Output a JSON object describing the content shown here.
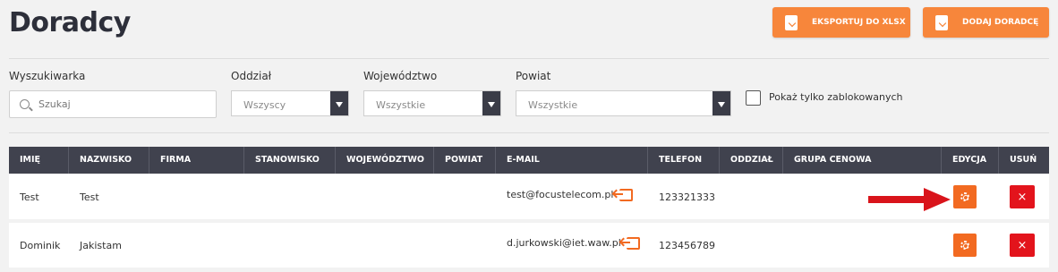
{
  "page": {
    "title": "Doradcy"
  },
  "toolbar": {
    "export_label": "EKSPORTUJ DO XLSX",
    "add_label": "DODAJ DORADCĘ"
  },
  "filters": {
    "search_label": "Wyszukiwarka",
    "search_placeholder": "Szukaj",
    "branch_label": "Oddział",
    "branch_value": "Wszyscy",
    "voivodeship_label": "Województwo",
    "voivodeship_value": "Wszystkie",
    "county_label": "Powiat",
    "county_value": "Wszystkie",
    "blocked_only_label": "Pokaż tylko zablokowanych"
  },
  "table": {
    "columns": [
      "IMIĘ",
      "NAZWISKO",
      "FIRMA",
      "STANOWISKO",
      "WOJEWÓDZTWO",
      "POWIAT",
      "E-MAIL",
      "TELEFON",
      "ODDZIAŁ",
      "GRUPA CENOWA",
      "EDYCJA",
      "USUŃ"
    ],
    "rows": [
      {
        "first_name": "Test",
        "last_name": "Test",
        "email": "test@focustelecom.pl",
        "phone": "123321333"
      },
      {
        "first_name": "Dominik",
        "last_name": "Jakistam",
        "email": "d.jurkowski@iet.waw.pl",
        "phone": "123456789"
      }
    ],
    "delete_glyph": "×"
  },
  "colors": {
    "accent": "#f7863b",
    "edit": "#f26a21",
    "delete": "#e3141c",
    "header": "#40424e",
    "annotation_arrow": "#d9141b"
  },
  "icons": {
    "export": "file-download-icon",
    "add": "file-add-icon",
    "email_action": "login-arrow-icon",
    "edit": "gear-icon",
    "delete": "close-icon"
  }
}
